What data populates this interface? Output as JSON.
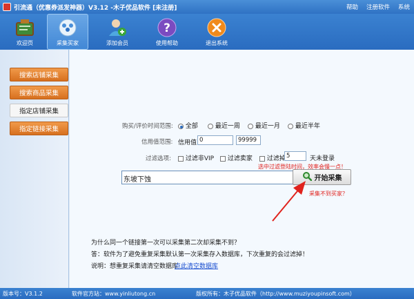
{
  "window": {
    "title": "引流通（优惠券派发神器）V3.12 -木子优品软件 [未注册]",
    "menu": [
      "帮助",
      "注册软件",
      "系统"
    ]
  },
  "toolbar": {
    "items": [
      {
        "label": "欢迎页",
        "icon": "shop-board-icon"
      },
      {
        "label": "采集买家",
        "icon": "users-group-icon"
      },
      {
        "label": "添加会员",
        "icon": "add-user-icon"
      },
      {
        "label": "使用帮助",
        "icon": "help-icon"
      },
      {
        "label": "退出系统",
        "icon": "close-icon"
      }
    ],
    "active_index": 1
  },
  "sidebar": {
    "items": [
      {
        "label": "搜索店铺采集"
      },
      {
        "label": "搜索商品采集"
      },
      {
        "label": "指定店铺采集"
      },
      {
        "label": "指定链接采集"
      }
    ],
    "active_index": 2
  },
  "form": {
    "time_range_label": "购买/评价时间范围:",
    "time_options": [
      "全部",
      "最近一周",
      "最近一月",
      "最近半年"
    ],
    "time_selected": "全部",
    "credit_label": "信用值范围:",
    "credit_prefix": "信用值:",
    "credit_min": "0",
    "credit_sep": "-",
    "credit_max": "99999",
    "filter_label": "过滤选项:",
    "filter_vip": "过滤非VIP",
    "filter_seller": "过滤卖家",
    "filter_login": "过滤掉",
    "filter_days": "5",
    "filter_login_suffix": "天未登录",
    "filter_hint": "选中过滤登陆时间，效率会慢一点！",
    "keyword_value": "东坡下蚀",
    "start_button": "开始采集",
    "no_buyer_hint": "采集不到买家？"
  },
  "notes": {
    "q": "为什么同一个链接第一次可以采集第二次却采集不到？",
    "a": "答：软件为了避免重复采集默认第一次采集存入数据库，下次重复的会过滤掉！",
    "desc": "说明：想重复采集请清空数据库",
    "clear_link": "点此清空数据库"
  },
  "status": {
    "version": "版本号：V3.1.2",
    "site": "软件官方站：www.yinliutong.cn",
    "owner": "版权所有：木子优品软件（http://www.muziyoupinsoft.com）"
  },
  "colors": {
    "title_blue": "#2f72c4",
    "sidebar_orange": "#e07a2a",
    "hint_red": "#e0221d",
    "link_blue": "#1a4fd0"
  }
}
